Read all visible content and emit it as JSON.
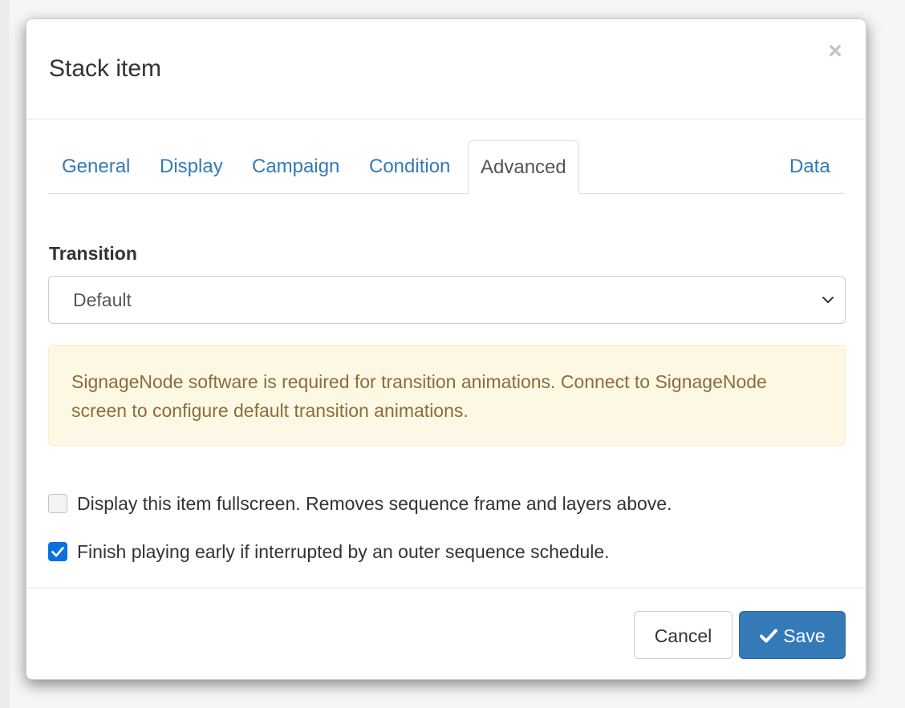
{
  "modal": {
    "title": "Stack item",
    "close_label": "×"
  },
  "tabs": [
    {
      "label": "General",
      "active": false
    },
    {
      "label": "Display",
      "active": false
    },
    {
      "label": "Campaign",
      "active": false
    },
    {
      "label": "Condition",
      "active": false
    },
    {
      "label": "Advanced",
      "active": true
    },
    {
      "label": "Data",
      "active": false
    }
  ],
  "transition": {
    "label": "Transition",
    "selected": "Default"
  },
  "alert": {
    "text": "SignageNode software is required for transition animations. Connect to SignageNode screen to configure default transition animations."
  },
  "options": {
    "fullscreen": {
      "label": "Display this item fullscreen. Removes sequence frame and layers above.",
      "checked": false
    },
    "finish_early": {
      "label": "Finish playing early if interrupted by an outer sequence schedule.",
      "checked": true
    }
  },
  "footer": {
    "cancel_label": "Cancel",
    "save_label": "Save",
    "save_icon": "check-icon"
  },
  "colors": {
    "link": "#337ab7",
    "primary_button": "#337ab7",
    "alert_background": "#fcf8e3",
    "alert_text": "#8a6d3b",
    "checkbox_checked": "#0b6fe0"
  }
}
